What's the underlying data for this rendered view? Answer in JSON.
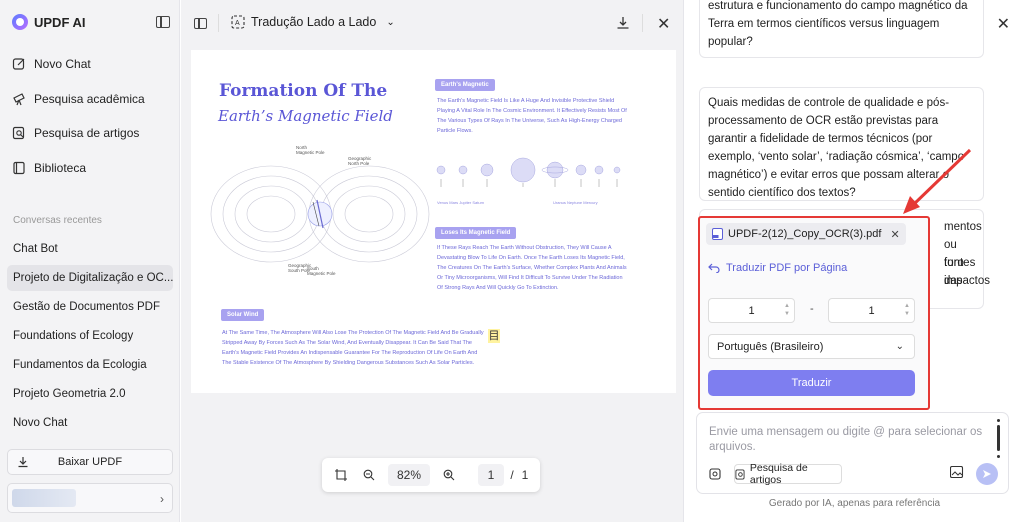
{
  "sidebar": {
    "brand": "UPDF AI",
    "nav": [
      {
        "label": "Novo Chat",
        "icon": "edit-icon"
      },
      {
        "label": "Pesquisa acadêmica",
        "icon": "telescope-icon"
      },
      {
        "label": "Pesquisa de artigos",
        "icon": "search-doc-icon"
      },
      {
        "label": "Biblioteca",
        "icon": "library-icon"
      }
    ],
    "section_label": "Conversas recentes",
    "conversations": [
      "Chat Bot",
      "Projeto de Digitalização e OC...",
      "Gestão de Documentos PDF",
      "Foundations of Ecology",
      "Fundamentos da Ecologia",
      "Projeto Geometria 2.0",
      "Novo Chat"
    ],
    "active_index": 1,
    "download_label": "Baixar UPDF"
  },
  "viewer": {
    "mode_label": "Tradução Lado a Lado",
    "zoom": "82%",
    "page_current": "1",
    "page_separator": "/",
    "page_total": "1",
    "pdf": {
      "title1": "Formation Of The",
      "title2": "Earth’s Magnetic Field",
      "tag1": "Earth's Magnetic",
      "para1": "The Earth's Magnetic Field Is Like A Huge And Invisible Protective Shield Playing A Vital Role In The Cosmic Environment. It Effectively Resists Most Of The Various Types Of Rays In The Universe, Such As High-Energy Charged Particle Flows.",
      "tag2": "Loses Its Magnetic Field",
      "para2": "If These Rays Reach The Earth Without Obstruction, They Will Cause A Devastating Blow To Life On Earth. Once The Earth Loses Its Magnetic Field, The Creatures On The Earth's Surface, Whether Complex Plants And Animals Or Tiny Microorganisms, Will Find It Difficult To Survive Under The Radiation Of Strong Rays And Will Quickly Go To Extinction.",
      "tag3": "Solar Wind",
      "para3": "At The Same Time, The Atmosphere Will Also Lose The Protection Of The Magnetic Field And Be Gradually Stripped Away By Forces Such As The Solar Wind, And Eventually Disappear. It Can Be Said That The Earth's Magnetic Field Provides An Indispensable Guarantee For The Reproduction Of Life On Earth And The Stable Existence Of The Atmosphere By Shielding Dangerous Substances Such As Solar Particles.",
      "diagram_labels": [
        "North Magnetic Pole",
        "Geographic North Pole",
        "Geographic South Pole",
        "South Magnetic Pole"
      ],
      "planet_labels_left": "Venus Mars Jupiter Saturn",
      "planet_labels_right": "Uranus Neptune Mercury",
      "highlight_glyph": "目"
    }
  },
  "chat": {
    "msg_top_partial": "estrutura e funcionamento do campo magnético da Terra em termos científicos versus linguagem popular?",
    "msg_question": "Quais medidas de controle de qualidade e pós-processamento de OCR estão previstas para garantir a fidelidade de termos técnicos (por exemplo, ‘vento solar’, ‘radiação cósmica’, ‘campo magnético’) e evitar erros que possam alterar o sentido científico dos textos?",
    "msg_hidden_fragments": [
      "mentos",
      "ou fontes",
      "turo das",
      "impactos"
    ],
    "translate_card": {
      "file_name": "UPDF-2(12)_Copy_OCR(3).pdf",
      "link_label": "Traduzir PDF por Página",
      "page_from": "1",
      "page_to": "1",
      "dash": "-",
      "language": "Português (Brasileiro)",
      "button_label": "Traduzir"
    },
    "composer_placeholder": "Envie uma mensagem ou digite @ para selecionar os arquivos.",
    "tool_label": "Pesquisa de artigos",
    "footer_note": "Gerado por IA, apenas para referência"
  },
  "colors": {
    "accent": "#7e7ef0",
    "pdf_purple": "#5a56d6",
    "highlight_border": "#e53935"
  }
}
